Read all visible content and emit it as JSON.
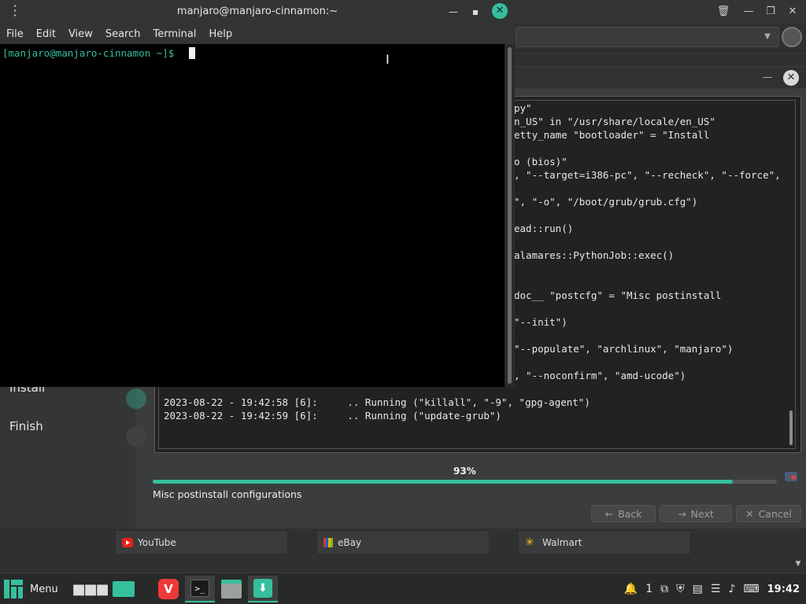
{
  "terminal": {
    "title": "manjaro@manjaro-cinnamon:~",
    "menu": [
      "File",
      "Edit",
      "View",
      "Search",
      "Terminal",
      "Help"
    ],
    "prompt": "[manjaro@manjaro-cinnamon ~]$ "
  },
  "installer": {
    "sidebar_steps": [
      "Install",
      "Finish"
    ],
    "log_lines": [
      "py\"",
      "n_US\" in \"/usr/share/locale/en_US\"",
      "etty_name \"bootloader\" = \"Install",
      "",
      "o (bios)\"",
      ", \"--target=i386-pc\", \"--recheck\", \"--force\",",
      "",
      "\", \"-o\", \"/boot/grub/grub.cfg\")",
      "",
      "ead::run()",
      "",
      "alamares::PythonJob::exec()",
      "",
      "",
      "doc__ \"postcfg\" = \"Misc postinstall",
      "",
      "\"--init\")",
      "",
      "\"--populate\", \"archlinux\", \"manjaro\")",
      "",
      ", \"--noconfirm\", \"amd-ucode\")",
      "",
      "2023-08-22 - 19:42:58 [6]:     .. Running (\"killall\", \"-9\", \"gpg-agent\")",
      "2023-08-22 - 19:42:59 [6]:     .. Running (\"update-grub\")"
    ],
    "progress_text": "93%",
    "progress_value": 0.93,
    "status": "Misc postinstall configurations",
    "back_label": "Back",
    "next_label": "Next",
    "cancel_label": "Cancel"
  },
  "browser": {
    "speed_dials": [
      {
        "label": "YouTube",
        "icon": "youtube-icon"
      },
      {
        "label": "eBay",
        "icon": "ebay-icon"
      },
      {
        "label": "Walmart",
        "icon": "walmart-icon"
      }
    ]
  },
  "taskbar": {
    "menu_label": "Menu",
    "notification_count": "1",
    "clock": "19:42"
  },
  "colors": {
    "accent": "#35bf9d",
    "terminal_bg": "#000000"
  }
}
